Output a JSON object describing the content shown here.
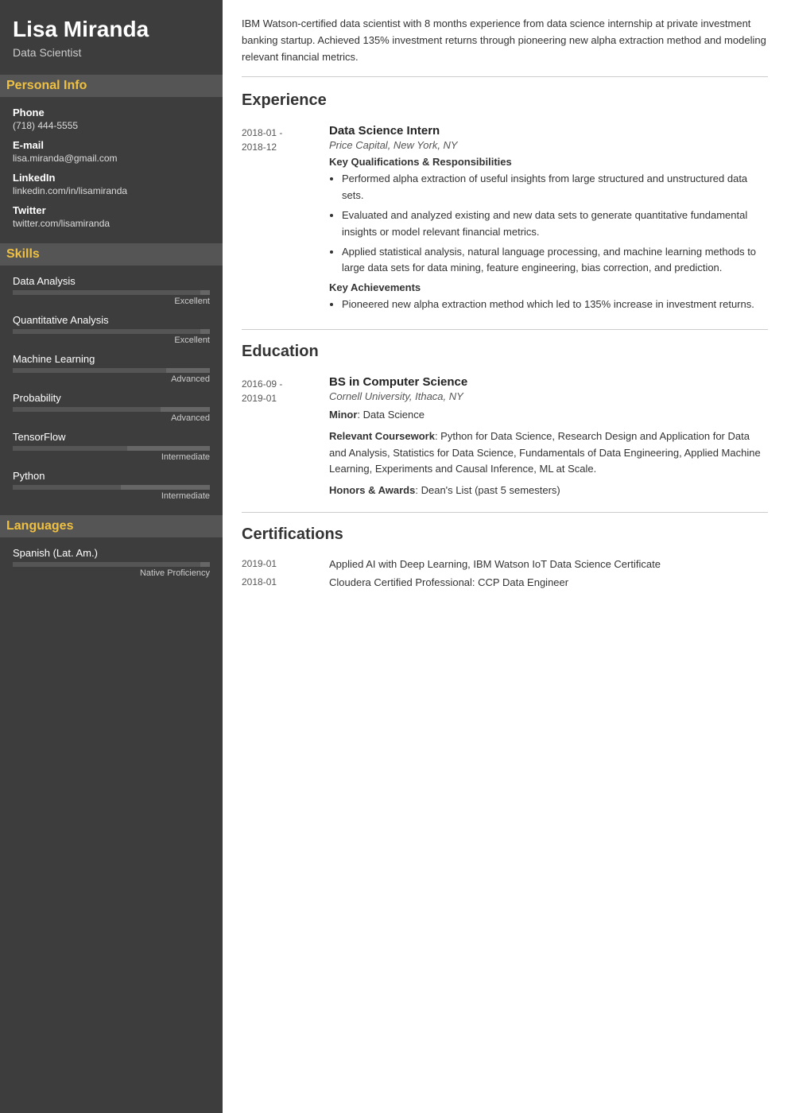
{
  "sidebar": {
    "name": "Lisa Miranda",
    "title": "Data Scientist",
    "sections": {
      "personal_info": {
        "label": "Personal Info",
        "fields": [
          {
            "label": "Phone",
            "value": "(718) 444-5555"
          },
          {
            "label": "E-mail",
            "value": "lisa.miranda@gmail.com"
          },
          {
            "label": "LinkedIn",
            "value": "linkedin.com/in/lisamiranda"
          },
          {
            "label": "Twitter",
            "value": "twitter.com/lisamiranda"
          }
        ]
      },
      "skills": {
        "label": "Skills",
        "items": [
          {
            "name": "Data Analysis",
            "level": "Excellent",
            "pct": 95
          },
          {
            "name": "Quantitative Analysis",
            "level": "Excellent",
            "pct": 95
          },
          {
            "name": "Machine Learning",
            "level": "Advanced",
            "pct": 80
          },
          {
            "name": "Probability",
            "level": "Advanced",
            "pct": 78
          },
          {
            "name": "TensorFlow",
            "level": "Intermediate",
            "pct": 60
          },
          {
            "name": "Python",
            "level": "Intermediate",
            "pct": 58
          }
        ]
      },
      "languages": {
        "label": "Languages",
        "items": [
          {
            "name": "Spanish (Lat. Am.)",
            "level": "Native Proficiency",
            "pct": 95
          }
        ]
      }
    }
  },
  "main": {
    "summary": "IBM Watson-certified data scientist with 8 months experience from data science internship at private investment banking startup. Achieved 135% investment returns through pioneering new alpha extraction method and modeling relevant financial metrics.",
    "experience": {
      "label": "Experience",
      "entries": [
        {
          "date_start": "2018-01",
          "date_end": "2018-12",
          "title": "Data Science Intern",
          "company": "Price Capital, New York, NY",
          "qualifications_label": "Key Qualifications & Responsibilities",
          "bullets": [
            "Performed alpha extraction of useful insights from large structured and unstructured data sets.",
            "Evaluated and analyzed existing and new data sets to generate quantitative fundamental insights or model relevant financial metrics.",
            "Applied statistical analysis, natural language processing, and machine learning methods to large data sets for data mining, feature engineering, bias correction, and prediction."
          ],
          "achievements_label": "Key Achievements",
          "achievements": [
            "Pioneered new alpha extraction method which led to 135% increase in investment returns."
          ]
        }
      ]
    },
    "education": {
      "label": "Education",
      "entries": [
        {
          "date_start": "2016-09",
          "date_end": "2019-01",
          "degree": "BS in Computer Science",
          "school": "Cornell University, Ithaca, NY",
          "minor_label": "Minor",
          "minor": "Data Science",
          "coursework_label": "Relevant Coursework",
          "coursework": "Python for Data Science, Research Design and Application for Data and Analysis, Statistics for Data Science, Fundamentals of Data Engineering, Applied Machine Learning, Experiments and Causal Inference, ML at Scale.",
          "honors_label": "Honors & Awards",
          "honors": "Dean's List (past 5 semesters)"
        }
      ]
    },
    "certifications": {
      "label": "Certifications",
      "entries": [
        {
          "date": "2019-01",
          "name": "Applied AI with Deep Learning, IBM Watson IoT Data Science Certificate"
        },
        {
          "date": "2018-01",
          "name": "Cloudera Certified Professional: CCP Data Engineer"
        }
      ]
    }
  }
}
